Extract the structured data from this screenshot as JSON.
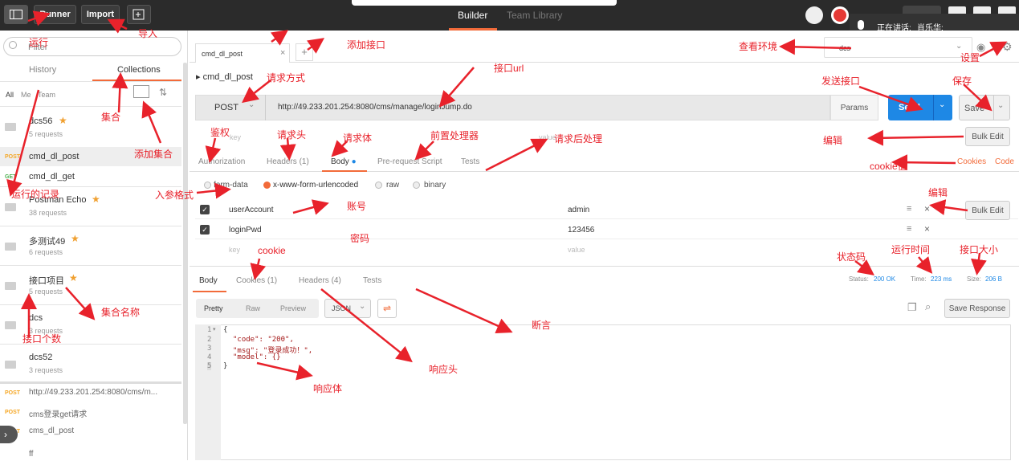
{
  "topbar": {
    "runner": "Runner",
    "import": "Import",
    "builder_tab": "Builder",
    "team_library_tab": "Team Library",
    "speaking_label": "正在讲话:",
    "speaker_name": "肖乐华;"
  },
  "sidebar": {
    "filter_placeholder": "Filter",
    "tab_history": "History",
    "tab_collections": "Collections",
    "filter_all": "All",
    "filter_me": "Me",
    "filter_team": "Team",
    "collections": [
      {
        "name": "dcs56",
        "count": "5 requests",
        "starred": true
      },
      {
        "name": "Postman Echo",
        "count": "38 requests",
        "starred": true
      },
      {
        "name": "多测试49",
        "count": "6 requests",
        "starred": true
      },
      {
        "name": "接口项目",
        "count": "5 requests",
        "starred": true
      },
      {
        "name": "dcs",
        "count": "3 requests",
        "starred": false
      },
      {
        "name": "dcs52",
        "count": "3 requests",
        "starred": false
      }
    ],
    "dcs56_requests": [
      {
        "method": "POST",
        "name": "cmd_dl_post"
      },
      {
        "method": "GET",
        "name": "cmd_dl_get"
      }
    ],
    "history": [
      {
        "method": "POST",
        "name": "http://49.233.201.254:8080/cms/m..."
      },
      {
        "method": "POST",
        "name": "cms登录get请求"
      },
      {
        "method": "POST",
        "name": "cms_dl_post"
      },
      {
        "method": "",
        "name": "ff"
      }
    ]
  },
  "request": {
    "tab_name": "cmd_dl_post",
    "add_tab": "+",
    "title": "cmd_dl_post",
    "method": "POST",
    "url": "http://49.233.201.254:8080/cms/manage/loginJump.do",
    "params_btn": "Params",
    "send_btn": "Send",
    "save_btn": "Save",
    "environment": "dcs",
    "header_key_placeholder": "key",
    "header_value_placeholder": "value",
    "bulk_edit": "Bulk Edit",
    "tabs": [
      "Authorization",
      "Headers (1)",
      "Body",
      "Pre-request Script",
      "Tests"
    ],
    "cookies_link": "Cookies",
    "code_link": "Code",
    "body_types": [
      "form-data",
      "x-www-form-urlencoded",
      "raw",
      "binary"
    ],
    "body_rows": [
      {
        "key": "userAccount",
        "value": "admin"
      },
      {
        "key": "loginPwd",
        "value": "123456"
      }
    ],
    "new_key_placeholder": "key",
    "new_value_placeholder": "value"
  },
  "response": {
    "tabs": [
      "Body",
      "Cookies (1)",
      "Headers (4)",
      "Tests"
    ],
    "status_label": "Status:",
    "status": "200 OK",
    "time_label": "Time:",
    "time": "223 ms",
    "size_label": "Size:",
    "size": "206 B",
    "view_modes": [
      "Pretty",
      "Raw",
      "Preview"
    ],
    "format": "JSON",
    "save_response": "Save Response",
    "lines": [
      "{",
      "\"code\": \"200\",",
      "\"msg\": \"登录成功！\",",
      "\"model\": {}",
      "}"
    ],
    "line_numbers": [
      "1",
      "2",
      "3",
      "4",
      "5"
    ]
  },
  "annotations": {
    "run": "运行",
    "import": "导入",
    "add_interface": "添加接口",
    "view_env": "查看环境",
    "settings": "设置",
    "collection": "集合",
    "add_collection": "添加集合",
    "request_method": "请求方式",
    "interface_url": "接口url",
    "send_interface": "发送接口",
    "save": "保存",
    "auth": "鉴权",
    "request_header": "请求头",
    "request_body": "请求体",
    "pre_processor": "前置处理器",
    "post_processor": "请求后处理",
    "edit": "编辑",
    "cookie_code": "cookie值",
    "run_records": "运行的记录",
    "param_format": "入参格式",
    "account": "账号",
    "password": "密码",
    "edit2": "编辑",
    "cookie": "cookie",
    "status_code": "状态码",
    "run_time": "运行时间",
    "interface_size": "接口大小",
    "collection_name": "集合名称",
    "interface_count": "接口个数",
    "assertion": "断言",
    "response_header": "响应头",
    "response_body": "响应体"
  },
  "colors": {
    "accent": "#f26b3a",
    "send": "#1e88e5",
    "annotation": "#e8222b"
  }
}
